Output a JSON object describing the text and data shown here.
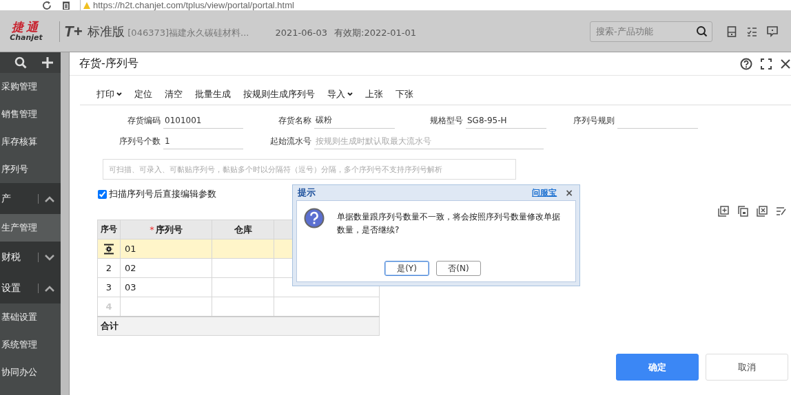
{
  "browser": {
    "url": "https://h2t.chanjet.com/tplus/view/portal/portal.html"
  },
  "header": {
    "logo": {
      "name": "捷通",
      "latin": "Chanjet"
    },
    "product_mark": "T+",
    "edition": "标准版",
    "company": "[046373]福建永久碳硅材料...",
    "date": "2021-06-03",
    "validity": "有效期:2022-01-01",
    "search": {
      "placeholder": "搜索-产品功能"
    }
  },
  "sidebar": {
    "items": [
      {
        "kind": "item",
        "label": "采购管理",
        "selected": false
      },
      {
        "kind": "item",
        "label": "销售管理",
        "selected": false
      },
      {
        "kind": "item",
        "label": "库存核算",
        "selected": false
      },
      {
        "kind": "item",
        "label": "序列号",
        "selected": false
      },
      {
        "kind": "group",
        "label": "产",
        "expanded": true
      },
      {
        "kind": "item",
        "label": "生产管理",
        "selected": true
      },
      {
        "kind": "group",
        "label": "财税",
        "expanded": false
      },
      {
        "kind": "group",
        "label": "设置",
        "expanded": true
      },
      {
        "kind": "item",
        "label": "基础设置",
        "selected": false
      },
      {
        "kind": "item",
        "label": "系统管理",
        "selected": false
      },
      {
        "kind": "item",
        "label": "协同办公",
        "selected": false
      }
    ]
  },
  "window": {
    "title": "存货-序列号",
    "toolbar": [
      {
        "label": "打印",
        "dropdown": true
      },
      {
        "label": "定位",
        "dropdown": false
      },
      {
        "label": "清空",
        "dropdown": false
      },
      {
        "label": "批量生成",
        "dropdown": false
      },
      {
        "label": "按规则生成序列号",
        "dropdown": false
      },
      {
        "label": "导入",
        "dropdown": true
      },
      {
        "label": "上张",
        "dropdown": false
      },
      {
        "label": "下张",
        "dropdown": false
      }
    ],
    "fields": [
      {
        "label": "存货编码",
        "value": "0101001"
      },
      {
        "label": "存货名称",
        "value": "碳粉"
      },
      {
        "label": "规格型号",
        "value": "SG8-95-H"
      },
      {
        "label": "序列号规则"
      },
      {
        "label": "序列号个数",
        "value": "1"
      },
      {
        "label": "起始流水号",
        "placeholder": "按规则生成时默认取最大流水号",
        "wide": true
      }
    ],
    "scan_input": {
      "placeholder": "可扫描、可录入、可黏贴序列号，黏贴多个时以分隔符（逗号）分隔，多个序列号不支持序列号解析"
    },
    "edit_after_scan": {
      "label": "扫描序列号后直接编辑参数",
      "checked": true
    },
    "table": {
      "columns": [
        {
          "label": "序号"
        },
        {
          "label": "序列号",
          "required_mark": "*"
        },
        {
          "label": "仓库"
        }
      ],
      "rows": [
        {
          "selected": true,
          "serial": "01"
        },
        {
          "number": "2",
          "serial": "02",
          "selected": false
        },
        {
          "number": "3",
          "serial": "03",
          "selected": false
        },
        {
          "number": "4",
          "selected": false,
          "kind": "blank"
        }
      ],
      "footer": "合计"
    },
    "buttons": [
      {
        "label": "确定",
        "primary": true
      },
      {
        "label": "取消",
        "primary": false
      }
    ]
  },
  "dialog": {
    "title": "提示",
    "help_link": "问服宝",
    "close": "×",
    "message": "单据数量跟序列号数量不一致，将会按照序列号数量修改单据数量，是否继续?",
    "buttons": [
      {
        "label": "是(Y)",
        "focused": true
      },
      {
        "label": "否(N)",
        "focused": false
      }
    ]
  }
}
